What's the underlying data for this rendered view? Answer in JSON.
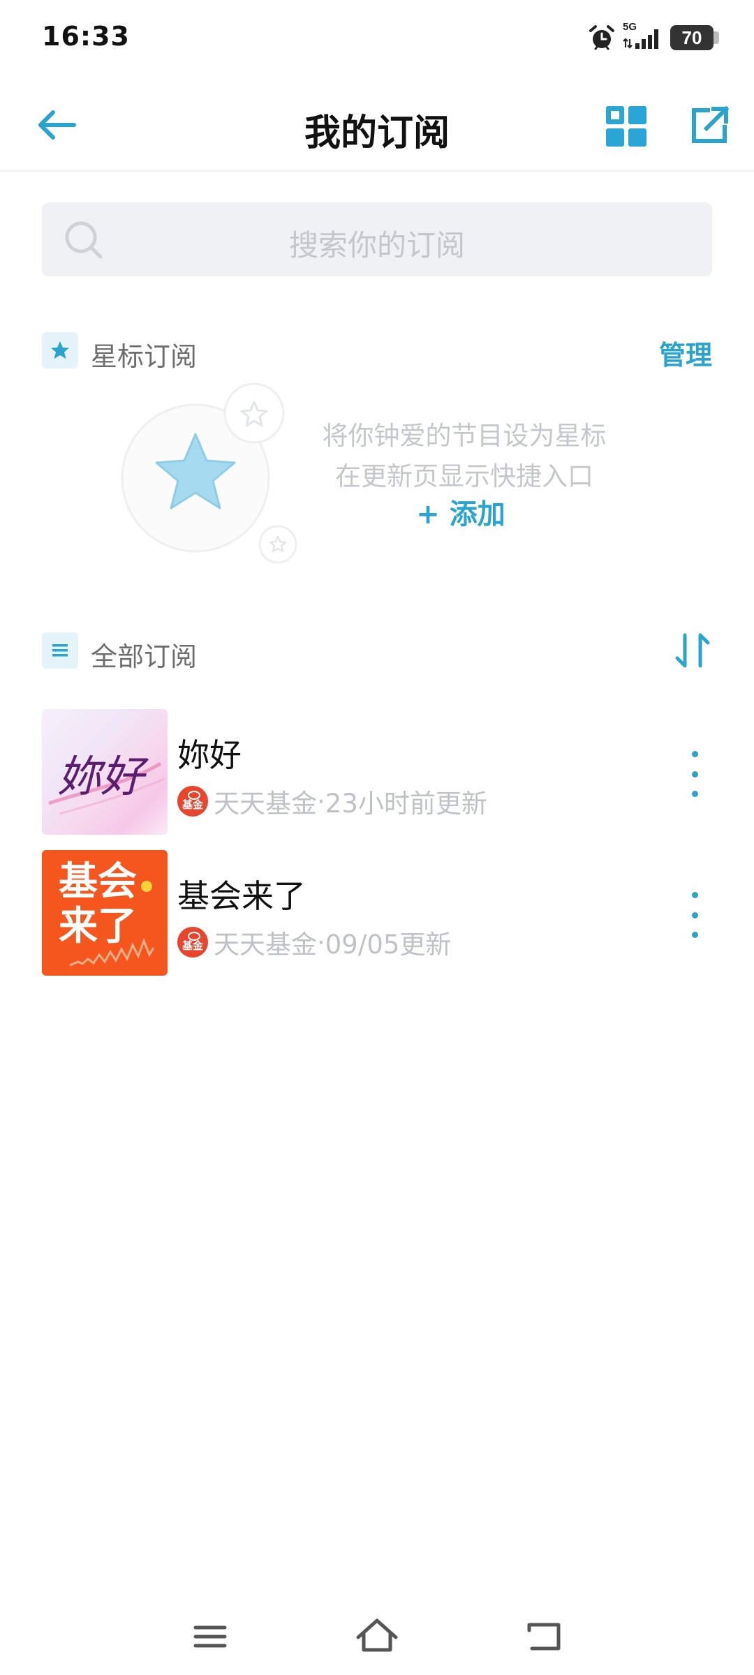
{
  "status_bar": {
    "time": "16:33",
    "network": "5G",
    "battery": "70"
  },
  "header": {
    "title": "我的订阅",
    "icons": [
      "back-arrow-icon",
      "grid-view-icon",
      "share-external-icon"
    ]
  },
  "search": {
    "placeholder": "搜索你的订阅"
  },
  "starred": {
    "label": "星标订阅",
    "manage_label": "管理",
    "hint_line1": "将你钟爱的节目设为星标",
    "hint_line2": "在更新页显示快捷入口",
    "add_label": "+ 添加"
  },
  "all": {
    "label": "全部订阅",
    "items": [
      {
        "title": "妳好",
        "cover_text": "妳好",
        "publisher": "天天基金",
        "publisher_logo_text": "基金",
        "update": "23小时前更新"
      },
      {
        "title": "基会来了",
        "cover_text_line1": "基会",
        "cover_text_line2": "来了",
        "publisher": "天天基金",
        "publisher_logo_text": "基金",
        "update": "09/05更新"
      }
    ]
  },
  "meta_separator": " · ",
  "colors": {
    "accent": "#2aa4cf",
    "grid_icon": "#29a6d6",
    "orange_cover": "#f4561e",
    "publisher_logo": "#e8452c"
  },
  "nav_bar": {
    "icons": [
      "menu-icon",
      "home-icon",
      "back-icon"
    ]
  }
}
